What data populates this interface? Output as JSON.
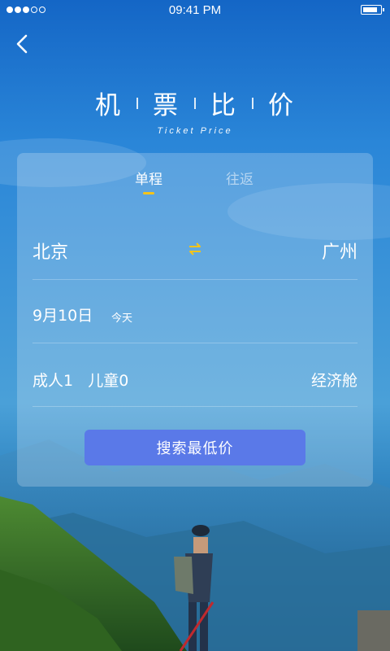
{
  "status_bar": {
    "time": "09:41 PM",
    "battery_level": 0.7,
    "signal_dots_filled": 3,
    "signal_dots_total": 5
  },
  "header": {
    "title_chars": [
      "机",
      "票",
      "比",
      "价"
    ],
    "subtitle": "Ticket Price"
  },
  "tabs": [
    {
      "label": "单程",
      "active": true
    },
    {
      "label": "往返",
      "active": false
    }
  ],
  "route": {
    "from": "北京",
    "to": "广州"
  },
  "date": {
    "value": "9月10日",
    "tag": "今天"
  },
  "passengers": {
    "text": "成人1   儿童0",
    "cabin": "经济舱"
  },
  "search_button": "搜索最低价",
  "colors": {
    "accent_yellow": "#f5c419",
    "button_blue": "#5a79e8"
  },
  "icons": [
    "back-arrow-icon",
    "swap-icon",
    "battery-icon",
    "signal-icon"
  ]
}
